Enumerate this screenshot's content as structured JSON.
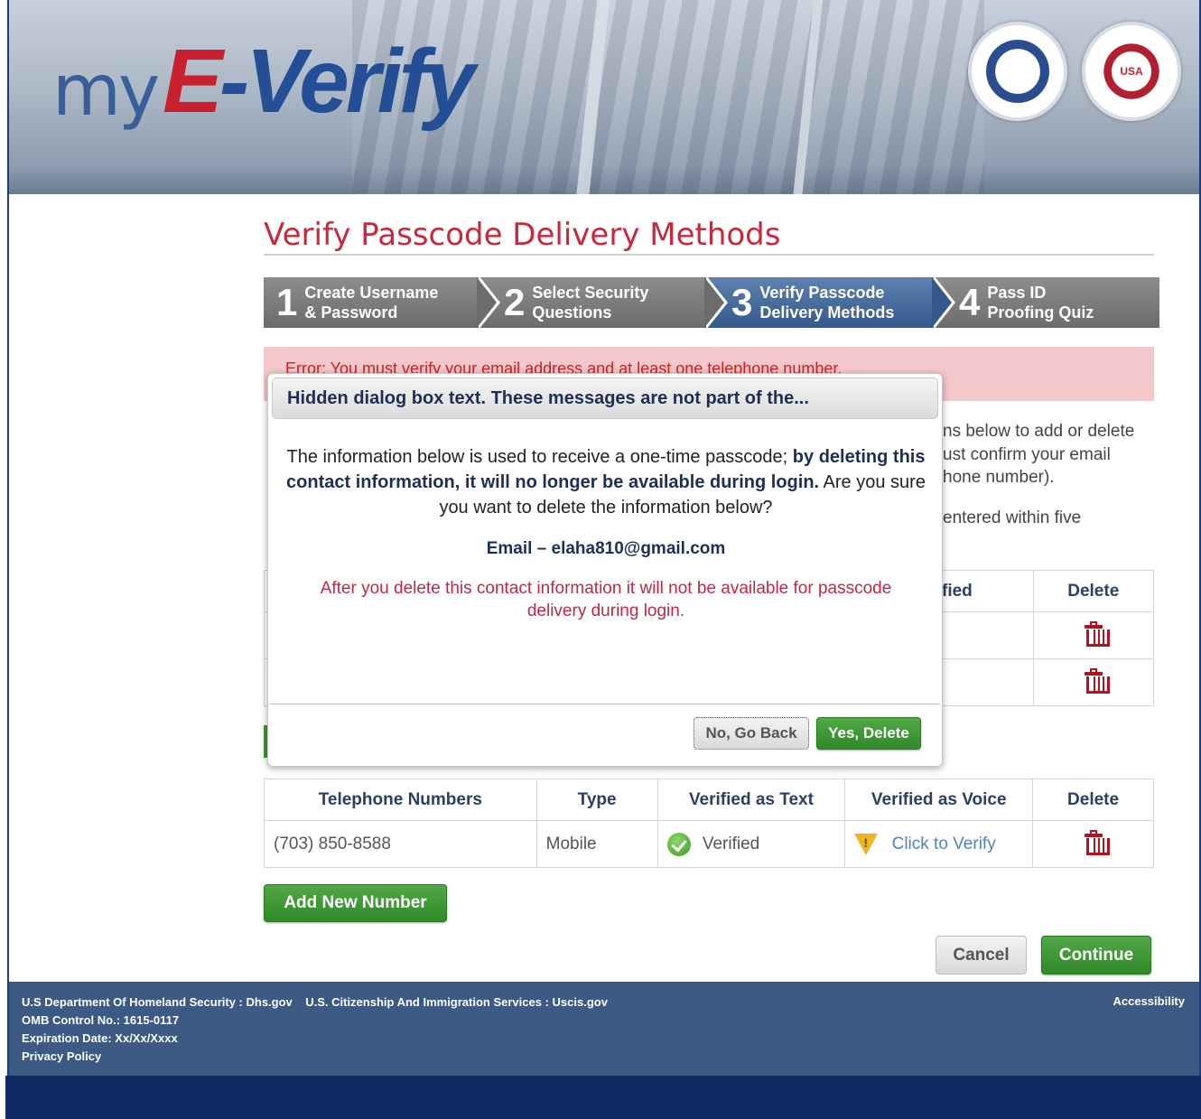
{
  "header": {
    "logo_my": "my",
    "logo_e": "E",
    "logo_verify": "-Verify",
    "seal_dhs_text": "",
    "seal_ssa_text": "USA"
  },
  "page_title": "Verify Passcode Delivery Methods",
  "steps": [
    {
      "num": "1",
      "line1": "Create Username",
      "line2": "& Password"
    },
    {
      "num": "2",
      "line1": "Select Security",
      "line2": "Questions"
    },
    {
      "num": "3",
      "line1": "Verify Passcode",
      "line2": "Delivery Methods"
    },
    {
      "num": "4",
      "line1": "Pass ID",
      "line2": "Proofing Quiz"
    }
  ],
  "error_text": "Error: You must verify your email address and at least one telephone number.",
  "instructions": {
    "line1": "ns below to add or delete",
    "line2": "ust confirm your email",
    "line3": "hone number).",
    "line4": "entered within five"
  },
  "email_table": {
    "col_verified": "fied",
    "col_delete": "Delete"
  },
  "phone_table": {
    "headers": [
      "Telephone Numbers",
      "Type",
      "Verified as Text",
      "Verified as Voice",
      "Delete"
    ],
    "rows": [
      {
        "number": "(703) 850-8588",
        "type": "Mobile",
        "text_status": "Verified",
        "voice_status": "Click to Verify"
      }
    ]
  },
  "buttons": {
    "add_number": "Add New Number",
    "cancel": "Cancel",
    "continue": "Continue"
  },
  "footer": {
    "line1": "U.S Department Of Homeland Security : Dhs.gov    U.S. Citizenship And Immigration Services : Uscis.gov",
    "line2": "OMB Control No.: 1615-0117",
    "line3": "Expiration Date: Xx/Xx/Xxxx",
    "line4": "Privacy Policy",
    "accessibility": "Accessibility"
  },
  "modal": {
    "title": "Hidden dialog box text. These messages are not part of the...",
    "body_part1": "The information below is used to receive a one-time passcode; ",
    "body_bold": "by deleting this contact information, it will no longer be available during login.",
    "body_part2": " Are you sure you want to delete the information below?",
    "email": "Email – elaha810@gmail.com",
    "warning": "After you delete this contact information it will not be available for passcode delivery during login.",
    "no_button": "No, Go Back",
    "yes_button": "Yes, Delete"
  }
}
